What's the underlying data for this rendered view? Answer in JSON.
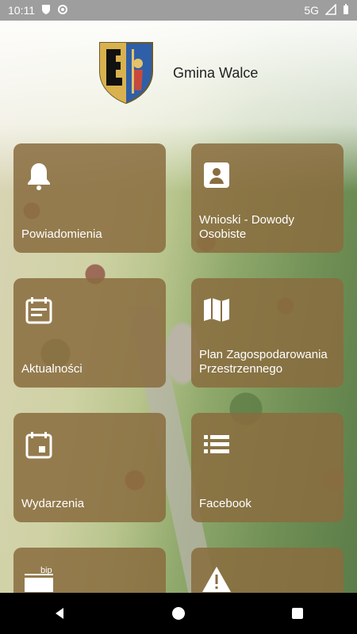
{
  "status_bar": {
    "time": "10:11",
    "network": "5G",
    "icons": [
      "shield-icon",
      "gear-icon",
      "signal-icon",
      "battery-icon"
    ]
  },
  "header": {
    "app_title": "Gmina Walce"
  },
  "tiles": [
    {
      "label": "Powiadomienia",
      "icon": "bell-icon"
    },
    {
      "label": "Wnioski - Dowody Osobiste",
      "icon": "contact-card-icon"
    },
    {
      "label": "Aktualności",
      "icon": "calendar-text-icon"
    },
    {
      "label": "Plan Zagospodarowania Przestrzennego",
      "icon": "map-icon"
    },
    {
      "label": "Wydarzenia",
      "icon": "calendar-icon"
    },
    {
      "label": "Facebook",
      "icon": "list-icon"
    },
    {
      "label": "",
      "icon": "bip-icon",
      "icon_text": "bip"
    },
    {
      "label": "",
      "icon": "warning-icon"
    }
  ],
  "navigation": {
    "buttons": [
      "back-icon",
      "home-icon",
      "recents-icon"
    ]
  },
  "colors": {
    "tile": "#896c3f",
    "status_bar": "#9e9e9e",
    "nav_bar": "#000000"
  }
}
